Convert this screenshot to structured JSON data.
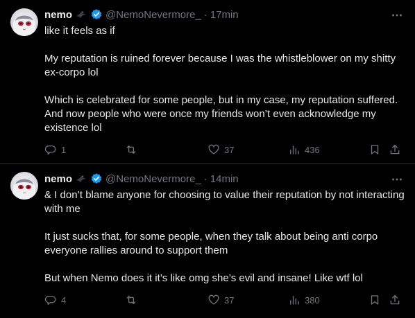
{
  "tweets": [
    {
      "author": {
        "name": "nemo",
        "handle": "@NemoNevermore_"
      },
      "separator": "·",
      "time": "17min",
      "paragraphs": [
        "like it feels as if",
        "My reputation is ruined forever because I was the whistleblower on my shitty ex-corpo lol",
        "Which is celebrated for some people, but in my case, my reputation suffered. And now people who were once my friends won’t even acknowledge my existence lol"
      ],
      "stats": {
        "replies": "1",
        "reposts": "",
        "likes": "37",
        "views": "436"
      }
    },
    {
      "author": {
        "name": "nemo",
        "handle": "@NemoNevermore_"
      },
      "separator": "·",
      "time": "14min",
      "paragraphs": [
        "& I don’t blame anyone for choosing to value their reputation by not interacting with me",
        "It just sucks that, for some people, when they talk about being anti corpo everyone rallies around to support them",
        "But when Nemo does it it’s like omg she’s evil and insane! Like wtf lol"
      ],
      "stats": {
        "replies": "4",
        "reposts": "",
        "likes": "37",
        "views": "380"
      }
    }
  ],
  "icons": {
    "verified": "verified-badge-icon",
    "emoji": "black-bird-emoji",
    "more": "more-dots-icon",
    "reply": "reply-icon",
    "repost": "repost-icon",
    "like": "heart-icon",
    "views": "views-chart-icon",
    "bookmark": "bookmark-icon",
    "share": "share-icon"
  },
  "colors": {
    "background": "#000000",
    "text": "#e7e9ea",
    "muted": "#71767b",
    "verified": "#1d9bf0",
    "divider": "#2f3336"
  }
}
